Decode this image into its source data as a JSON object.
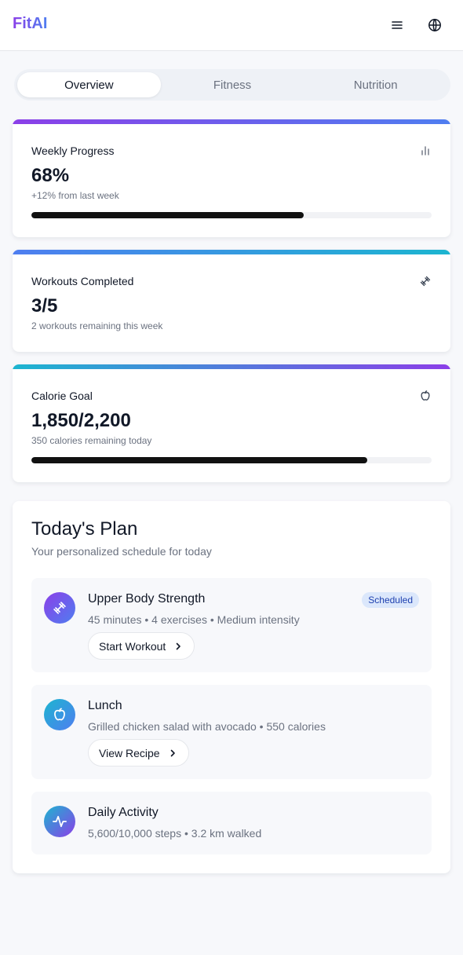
{
  "app": {
    "logo": "FitAI"
  },
  "header": {
    "menu_icon": "menu-icon",
    "language_icon": "globe-icon"
  },
  "tabs": [
    {
      "label": "Overview",
      "active": true
    },
    {
      "label": "Fitness",
      "active": false
    },
    {
      "label": "Nutrition",
      "active": false
    }
  ],
  "cards": {
    "weekly": {
      "title": "Weekly Progress",
      "value": "68%",
      "sub": "+12% from last week",
      "progress": 0.68,
      "icon": "bar-chart-icon",
      "gradient": [
        "#8b3fe8",
        "#4f7ef0"
      ]
    },
    "workouts": {
      "title": "Workouts Completed",
      "value": "3/5",
      "sub": "2 workouts remaining this week",
      "icon": "dumbbell-icon",
      "gradient": [
        "#4f7ef0",
        "#1cb5d0"
      ]
    },
    "calories": {
      "title": "Calorie Goal",
      "value": "1,850/2,200",
      "sub": "350 calories remaining today",
      "progress": 0.84,
      "icon": "apple-icon",
      "gradient": [
        "#1cb5d0",
        "#8b3fe8"
      ]
    }
  },
  "plan": {
    "title": "Today's Plan",
    "subtitle": "Your personalized schedule for today",
    "items": [
      {
        "title": "Upper Body Strength",
        "desc": "45 minutes • 4 exercises • Medium intensity",
        "badge": "Scheduled",
        "action": "Start Workout",
        "icon": "dumbbell-icon"
      },
      {
        "title": "Lunch",
        "desc": "Grilled chicken salad with avocado • 550 calories",
        "action": "View Recipe",
        "icon": "apple-icon"
      },
      {
        "title": "Daily Activity",
        "desc": "5,600/10,000 steps • 3.2 km walked",
        "icon": "activity-icon"
      }
    ]
  },
  "colors": {
    "accent": "#8b3fe8",
    "secondary": "#4f7ef0",
    "badge_bg": "#dbe7fb",
    "badge_text": "#1e40af"
  }
}
